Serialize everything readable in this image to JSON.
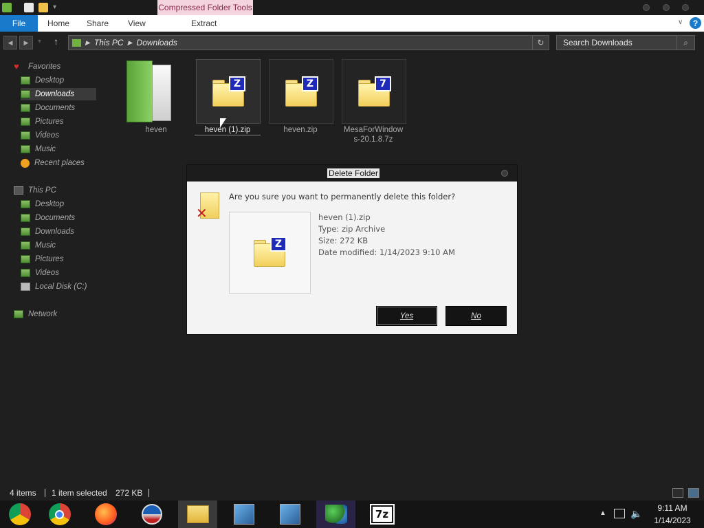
{
  "ribbon": {
    "context_tab": "Compressed Folder Tools",
    "file_tab": "File",
    "tabs": [
      "Home",
      "Share",
      "View"
    ],
    "context_subtab": "Extract"
  },
  "address": {
    "crumbs": [
      "This PC",
      "Downloads"
    ]
  },
  "search": {
    "placeholder": "Search Downloads"
  },
  "sidebar": {
    "favorites_label": "Favorites",
    "favorites": [
      "Desktop",
      "Downloads",
      "Documents",
      "Pictures",
      "Videos",
      "Music",
      "Recent places"
    ],
    "thispc_label": "This PC",
    "thispc": [
      "Desktop",
      "Documents",
      "Downloads",
      "Music",
      "Pictures",
      "Videos",
      "Local Disk (C:)"
    ],
    "network_label": "Network",
    "selected": "Downloads"
  },
  "files": [
    {
      "name": "heven",
      "kind": "folder",
      "icon": "green-folder-icon"
    },
    {
      "name": "heven (1).zip",
      "kind": "zip",
      "badge": "Z",
      "selected": true
    },
    {
      "name": "heven.zip",
      "kind": "zip",
      "badge": "Z"
    },
    {
      "name": "MesaForWindows-20.1.8.7z",
      "name_line1": "MesaForWindow",
      "name_line2": "s-20.1.8.7z",
      "kind": "7z",
      "badge": "7"
    }
  ],
  "dialog": {
    "title": "Delete Folder",
    "question": "Are you sure you want to permanently delete this folder?",
    "file_name": "heven (1).zip",
    "type": "Type: zip Archive",
    "size": "Size: 272 KB",
    "date_modified": "Date modified: 1/14/2023 9:10 AM",
    "yes_label": "Yes",
    "no_label": "No",
    "badge": "Z"
  },
  "status": {
    "items": "4 items",
    "selected": "1 item selected",
    "size": "272 KB"
  },
  "taskbar": {
    "apps": [
      "chrome-os-icon",
      "chrome-icon",
      "firefox-icon",
      "obama-icon",
      "file-explorer-icon",
      "installer-icon",
      "installer-icon-2",
      "messenger-icon",
      "7zip-icon"
    ],
    "seven_zip_label": "7z"
  },
  "clock": {
    "time": "9:11 AM",
    "date": "1/14/2023"
  },
  "colors": {
    "accent": "#1979ca",
    "context_tab_bg": "#f3d4df",
    "dialog_bg": "#f3f3f3",
    "window_bg": "#1f1f1f"
  }
}
